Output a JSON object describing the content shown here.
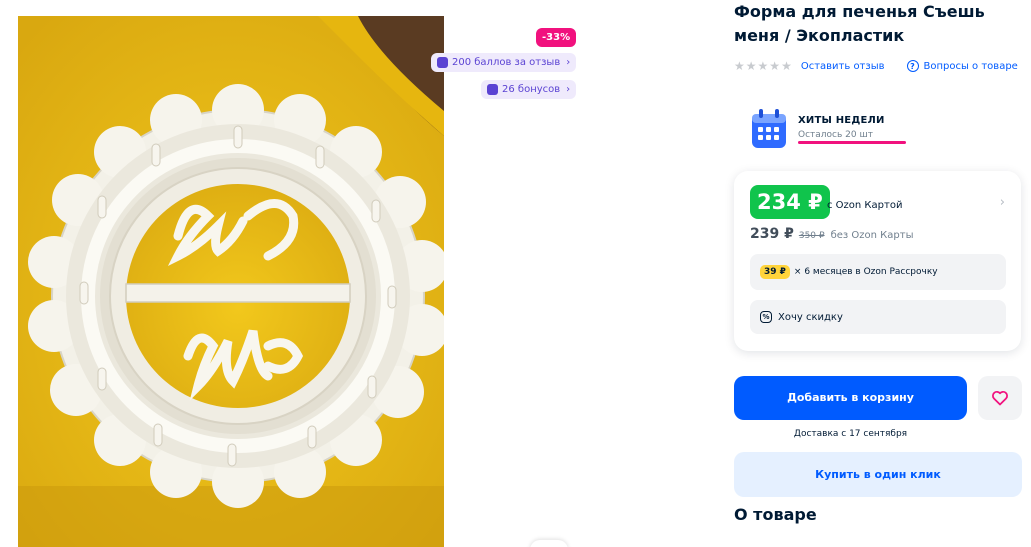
{
  "product": {
    "title": "Форма для печенья Съешь меня / Экопластик",
    "image_alt": "Форма для печенья"
  },
  "badges": {
    "discount": "-33%",
    "points": "200 баллов за отзыв",
    "bonus": "26 бонусов"
  },
  "rating": {
    "stars_filled": 0,
    "stars_total": 5,
    "leave_review": "Оставить отзыв",
    "questions": "Вопросы о товаре"
  },
  "hits": {
    "title": "ХИТЫ НЕДЕЛИ",
    "remaining": "Осталось 20 шт"
  },
  "price": {
    "card_price": "234 ₽",
    "card_label": "с Ozon Картой",
    "price": "239 ₽",
    "old_price": "350 ₽",
    "no_card_label": "без Ozon Карты",
    "installment_amount": "39 ₽",
    "installment_text": "× 6 месяцев в Ozon Рассрочку",
    "want_discount": "Хочу скидку"
  },
  "actions": {
    "add_to_cart": "Добавить в корзину",
    "delivery": "Доставка с 17 сентября",
    "buy_one_click": "Купить в один клик"
  },
  "section": {
    "about": "О товаре"
  },
  "colors": {
    "brand_blue": "#005bff",
    "green_price": "#10c44c",
    "discount_pink": "#f1117e",
    "bonus_purple": "#5b43d3"
  }
}
